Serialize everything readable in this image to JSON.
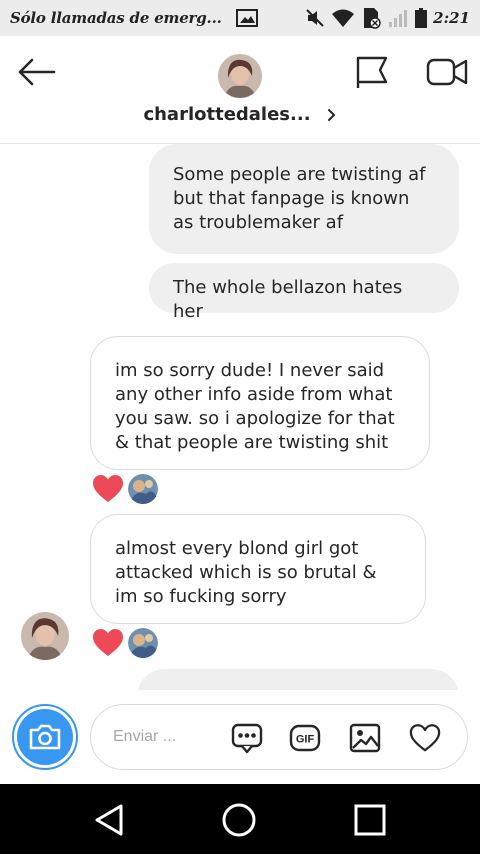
{
  "status_bar": {
    "carrier": "Sólo llamadas de emerg...",
    "time": "2:21"
  },
  "header": {
    "username": "charlottedales...",
    "icons": [
      "back-arrow-icon",
      "flag-icon",
      "video-camera-icon",
      "chevron-right-icon"
    ]
  },
  "messages": [
    {
      "direction": "outgoing",
      "text": "Some people are twisting af but that fanpage is known as troublemaker af"
    },
    {
      "direction": "outgoing",
      "text": "The whole bellazon hates her"
    },
    {
      "direction": "incoming",
      "text": "im so sorry dude! I never said any other info aside from what you saw. so i apologize for that & that people are twisting shit",
      "reaction": "heart"
    },
    {
      "direction": "incoming",
      "text": "almost every blond girl got attacked which is so brutal & im so fucking sorry",
      "reaction": "heart"
    },
    {
      "direction": "outgoing",
      "text": ""
    }
  ],
  "composer": {
    "placeholder": "Enviar ...",
    "gif_label": "GIF"
  },
  "colors": {
    "accent": "#3897f0",
    "heart": "#ed4956",
    "outgoing_bubble": "#efefef",
    "status_bar_bg": "#ececec"
  }
}
